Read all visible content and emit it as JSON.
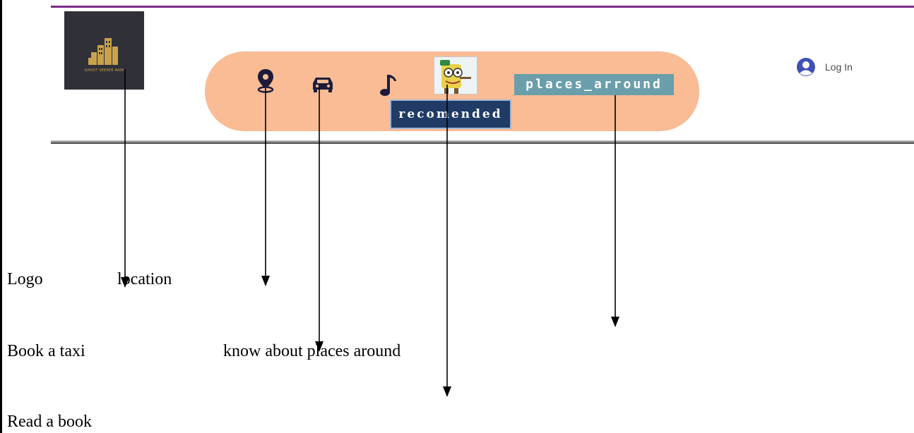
{
  "header": {
    "logo_text": "GHOST SEEKER RAIN",
    "nav": {
      "location_icon": "map-pin-icon",
      "taxi_icon": "car-icon",
      "music_icon": "music-note-icon",
      "recommended_label": "recomended",
      "places_label": "places_arround"
    },
    "login_label": "Log In"
  },
  "annotations": {
    "logo": "Logo",
    "location": "location",
    "taxi": "Book a taxi",
    "places": "know about places around",
    "book": "Read a book"
  },
  "colors": {
    "nav_pill": "#f9bc95",
    "top_line": "#7b2a8c",
    "recommended_bg": "#1f3b66",
    "places_bg": "#6a9eaa",
    "icon": "#1c1c3a"
  }
}
